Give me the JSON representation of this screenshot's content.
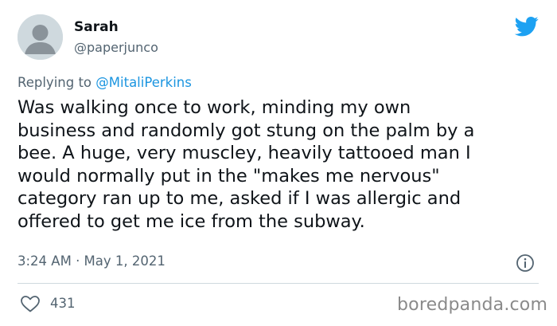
{
  "author": {
    "display_name": "Sarah",
    "handle": "@paperjunco"
  },
  "replying": {
    "prefix": "Replying to ",
    "mention": "@MitaliPerkins"
  },
  "tweet": {
    "text": "Was walking once to work, minding my own\nbusiness and randomly got stung on the palm by a\nbee. A huge, very muscley, heavily tattooed man I\nwould normally put in the \"makes me nervous\"\ncategory ran up to me, asked if I was allergic and\noffered to get me ice from the subway.",
    "timestamp": "3:24 AM · May 1, 2021"
  },
  "engagement": {
    "likes": "431"
  },
  "watermark": "boredpanda.com",
  "icons": {
    "logo": "twitter-bird-icon",
    "info": "info-icon",
    "like": "heart-icon",
    "avatar": "default-avatar-icon"
  },
  "colors": {
    "brand": "#1da1f2",
    "link": "#1b95e0",
    "secondary_text": "#536471",
    "primary_text": "#0f1419",
    "avatar_bg": "#cfd9de"
  }
}
